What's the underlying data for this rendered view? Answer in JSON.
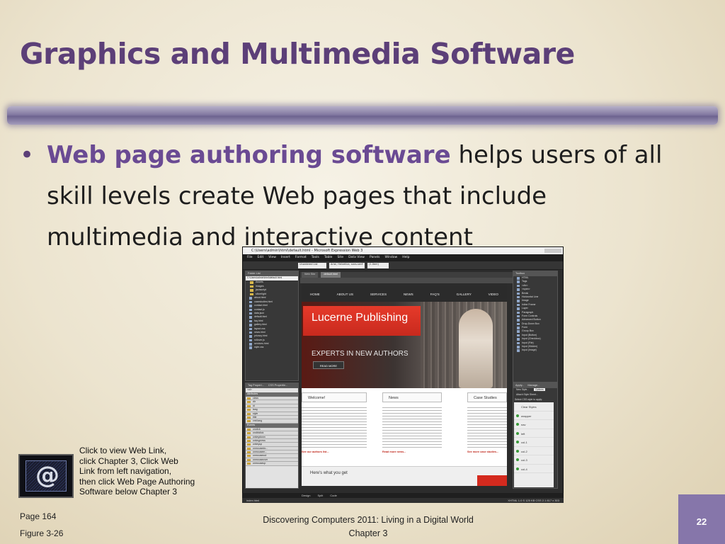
{
  "slide": {
    "title": "Graphics and Multimedia Software",
    "bullet_term": "Web page authoring software",
    "bullet_rest": " helps users of all skill levels create Web pages that include multimedia and interactive content",
    "note_lines": [
      "Click to view Web Link,",
      "click Chapter 3, Click Web",
      "Link from left navigation,",
      "then click Web Page Authoring",
      "Software below Chapter 3"
    ],
    "page_ref": "Page 164",
    "figure_ref": "Figure 3-26",
    "footer_line1": "Discovering Computers 2011: Living in a Digital World",
    "footer_line2": "Chapter 3",
    "slide_number": "22",
    "web_icon_symbol": "@"
  },
  "app": {
    "window_title": "C:\\Users\\admin\\html\\default.html - Microsoft Expression Web 3",
    "menu": [
      "File",
      "Edit",
      "View",
      "Insert",
      "Format",
      "Tools",
      "Table",
      "Site",
      "Data View",
      "Panels",
      "Window",
      "Help"
    ],
    "toolbar_style": "Unordered List",
    "toolbar_font": "Arial, Helvetica, sans-serif",
    "toolbar_size": "(1.0em)",
    "folder_list_title": "Folder List",
    "folder_path": "C:\\Users\\admin\\html\\default.html",
    "folders": [
      "Assets",
      "images",
      "javascript",
      "silverlight"
    ],
    "files": [
      "about.html",
      "casestudies.html",
      "contact.html",
      "contact.js",
      "data.json",
      "default.html",
      "faq.html",
      "gallery.html",
      "layout.css",
      "news.html",
      "privacy.html",
      "rollover.js",
      "services.html",
      "style.css"
    ],
    "tag_properties_title": "Tag Propert...",
    "css_properties_title": "CSS Propertie...",
    "tag_current": "<ul>",
    "attributes_header": "Attributes",
    "attributes": [
      "class",
      "dir",
      "id",
      "lang",
      "style",
      "title",
      "xml:lang"
    ],
    "events_header": "Events",
    "events": [
      "onclick",
      "ondblclick",
      "onkeydown",
      "onkeypress",
      "onkeyup",
      "onmousedo...",
      "onmousem...",
      "onmouseout",
      "onmouseover",
      "onmouseup"
    ],
    "tab_file": "Web Site",
    "tab_active": "default.html",
    "page_nav": [
      "HOME",
      "ABOUT US",
      "SERVICES",
      "NEWS",
      "FAQ'S",
      "GALLERY",
      "VIDEO"
    ],
    "hero_brand": "Lucerne Publishing",
    "hero_tagline": "EXPERTS IN NEW AUTHORS",
    "hero_button": "READ MORE",
    "col_welcome": "Welcome!",
    "col_news": "News",
    "col_cases": "Case Studies",
    "welcome_more": "See our authors list...",
    "news_more": "Read more news...",
    "cases_more": "See more case studies...",
    "heres_what": "Here's what you get",
    "toolbox_title": "Toolbox",
    "toolbox_items": [
      "HTML",
      "Tags",
      "<div>",
      "<span>",
      "Break",
      "Horizontal Line",
      "Image",
      "Inline Frame",
      "Layer",
      "Paragraph",
      "Form Controls",
      "Advanced Button",
      "Drop-Down Box",
      "Form",
      "Group Box",
      "Input (Button)",
      "Input (Checkbox)",
      "Input (File)",
      "Input (Hidden)",
      "Input (Image)"
    ],
    "apply_styles_title": "Apply...",
    "manage_styles_title": "Manage...",
    "new_style": "New Style...",
    "options": "Options",
    "attach_style": "Attach Style Sheet...",
    "select_css": "Select CSS style to apply:",
    "clear_styles": "Clear Styles",
    "css_styles": [
      "wrapper",
      "nav",
      "left",
      "col-1",
      "col-2",
      "col-3",
      "col-4"
    ],
    "view_tabs": [
      "Design",
      "Split",
      "Code"
    ],
    "status_left": "index.html",
    "status_right": "XHTML 1.0 S   125 KB   CSS 2.1   817 x 303"
  }
}
